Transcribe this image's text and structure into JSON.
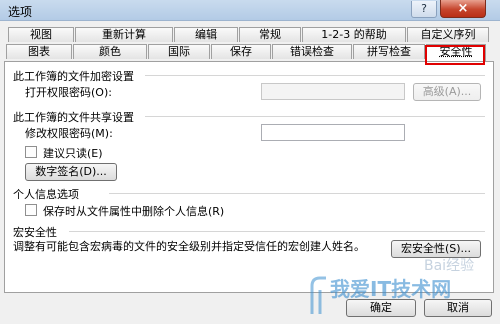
{
  "window": {
    "title": "选项",
    "close_glyph": "×",
    "help_glyph": "?"
  },
  "tabs_row1": [
    {
      "label": "视图"
    },
    {
      "label": "重新计算"
    },
    {
      "label": "编辑"
    },
    {
      "label": "常规"
    },
    {
      "label": "1-2-3 的帮助"
    },
    {
      "label": "自定义序列"
    }
  ],
  "tabs_row2": [
    {
      "label": "图表"
    },
    {
      "label": "颜色"
    },
    {
      "label": "国际"
    },
    {
      "label": "保存"
    },
    {
      "label": "错误检查"
    },
    {
      "label": "拼写检查"
    },
    {
      "label": "安全性"
    }
  ],
  "encryption": {
    "heading": "此工作簿的文件加密设置",
    "open_password_label": "打开权限密码(O):",
    "open_password_value": "",
    "advanced_button": "高级(A)..."
  },
  "sharing": {
    "heading": "此工作簿的文件共享设置",
    "modify_password_label": "修改权限密码(M):",
    "modify_password_value": "",
    "readonly_label": "建议只读(E)",
    "signature_button": "数字签名(D)..."
  },
  "privacy": {
    "heading": "个人信息选项",
    "remove_info_label": "保存时从文件属性中删除个人信息(R)"
  },
  "macro": {
    "heading": "宏安全性",
    "description": "调整有可能包含宏病毒的文件的安全级别并指定受信任的宏创建人姓名。",
    "button": "宏安全性(S)..."
  },
  "footer": {
    "ok": "确定",
    "cancel": "取消"
  },
  "watermark": {
    "top_text": "Bai经验",
    "brand_text": "我爱IT技术网"
  },
  "colors": {
    "highlight": "#e00000",
    "watermark": "#3c8fd0"
  }
}
